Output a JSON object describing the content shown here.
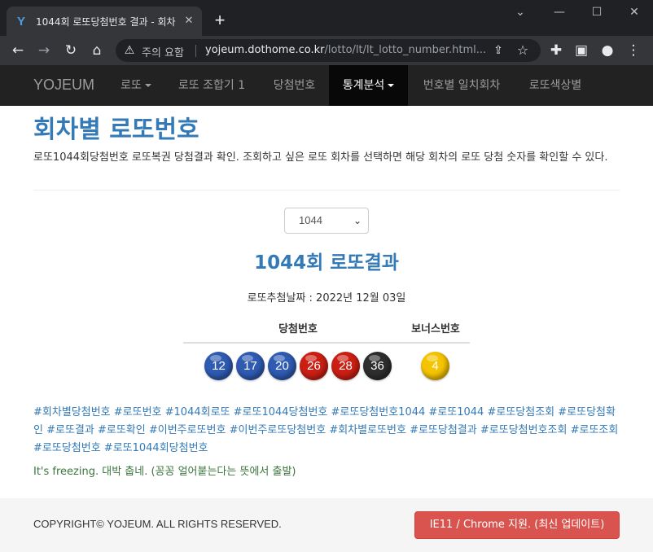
{
  "browser": {
    "tab_title": "1044회 로또당첨번호 결과 - 회차",
    "favicon_glyph": "Y",
    "new_tab_glyph": "+",
    "security_label": "주의 요함",
    "url_host": "yojeum.dothome.co.kr",
    "url_path": "/lotto/lt/lt_lotto_number.html...",
    "icons": [
      "back-icon",
      "forward-icon",
      "reload-icon",
      "home-icon",
      "warning-icon",
      "share-icon",
      "star-icon",
      "extensions-icon",
      "sidepanel-icon",
      "profile-icon",
      "menu-icon"
    ]
  },
  "navbar": {
    "brand": "YOJEUM",
    "items": [
      {
        "label": "로또",
        "dropdown": true
      },
      {
        "label": "로또 조합기 1",
        "dropdown": false
      },
      {
        "label": "당첨번호",
        "dropdown": false
      },
      {
        "label": "통계분석",
        "dropdown": true,
        "active": true
      },
      {
        "label": "번호별 일치회차",
        "dropdown": false
      },
      {
        "label": "로또색상별",
        "dropdown": false
      }
    ]
  },
  "main": {
    "title": "회차별 로또번호",
    "intro": "로또1044회당첨번호 로또복권 당첨결과 확인. 조회하고 싶은 로또 회차를 선택하면 해당 회차의 로또 당첨 숫자를 확인할 수 있다.",
    "round_select_value": "1044",
    "result_title": "1044회 로또결과",
    "draw_date": "로또추첨날짜 : 2022년 12월 03일",
    "winning_header": "당첨번호",
    "bonus_header": "보너스번호",
    "winning_numbers": [
      {
        "value": "12",
        "color": "#2f5bb3"
      },
      {
        "value": "17",
        "color": "#2f5bb3"
      },
      {
        "value": "20",
        "color": "#2f5bb3"
      },
      {
        "value": "26",
        "color": "#cc1f14"
      },
      {
        "value": "28",
        "color": "#cc1f14"
      },
      {
        "value": "36",
        "color": "#2e2e2e"
      }
    ],
    "bonus_number": {
      "value": "4",
      "color": "#f5c400"
    },
    "tags": [
      "#회차별당첨번호",
      "#로또번호",
      "#1044회로또",
      "#로또1044당첨번호",
      "#로또당첨번호1044",
      "#로또1044",
      "#로또당첨조회",
      "#로또당첨확인",
      "#로또결과",
      "#로또확인",
      "#이번주로또번호",
      "#이번주로또당첨번호",
      "#회차별로또번호",
      "#로또당첨결과",
      "#로또당첨번호조회",
      "#로또조회",
      "#로또당첨번호",
      "#로또1044회당첨번호"
    ],
    "saying": "It's freezing. 대박 춥네. (꽁꽁 얼어붙는다는 뜻에서 출발)"
  },
  "footer": {
    "copyright": "COPYRIGHT© YOJEUM. ALL RIGHTS RESERVED.",
    "support_button": "IE11 / Chrome 지원. (최신 업데이트)"
  }
}
